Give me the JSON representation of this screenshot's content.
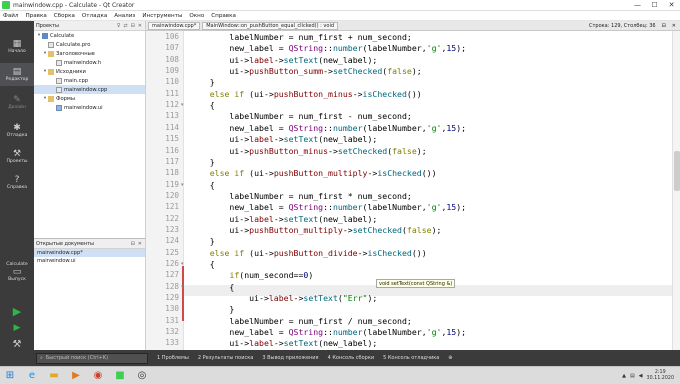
{
  "window": {
    "title": "mainwindow.cpp - Calculate - Qt Creator",
    "controls": [
      "—",
      "☐",
      "✕"
    ]
  },
  "menu": [
    "Файл",
    "Правка",
    "Сборка",
    "Отладка",
    "Анализ",
    "Инструменты",
    "Окно",
    "Справка"
  ],
  "modes": [
    {
      "label": "Начало",
      "icon": "grid-icon"
    },
    {
      "label": "Редактор",
      "icon": "editor-icon"
    },
    {
      "label": "Дизайн",
      "icon": "design-icon"
    },
    {
      "label": "Отладка",
      "icon": "debug-icon"
    },
    {
      "label": "Проекты",
      "icon": "projects-icon"
    },
    {
      "label": "Справка",
      "icon": "help-icon"
    }
  ],
  "kit": {
    "project": "Calculate",
    "mode": "Выпуск"
  },
  "projects_panel": {
    "title": "Проекты",
    "tree": [
      {
        "label": "Calculate",
        "level": 0,
        "arrow": "▾",
        "type": "project"
      },
      {
        "label": "Calculate.pro",
        "level": 1,
        "arrow": "",
        "type": "pro"
      },
      {
        "label": "Заголовочные",
        "level": 1,
        "arrow": "▾",
        "type": "folder"
      },
      {
        "label": "mainwindow.h",
        "level": 2,
        "arrow": "",
        "type": "h"
      },
      {
        "label": "Исходники",
        "level": 1,
        "arrow": "▾",
        "type": "folder"
      },
      {
        "label": "main.cpp",
        "level": 2,
        "arrow": "",
        "type": "cpp"
      },
      {
        "label": "mainwindow.cpp",
        "level": 2,
        "arrow": "",
        "type": "cpp",
        "selected": true
      },
      {
        "label": "Формы",
        "level": 1,
        "arrow": "▾",
        "type": "folder"
      },
      {
        "label": "mainwindow.ui",
        "level": 2,
        "arrow": "",
        "type": "ui"
      }
    ]
  },
  "open_docs": {
    "title": "Открытые документы",
    "items": [
      "mainwindow.cpp*",
      "mainwindow.ui"
    ]
  },
  "editor_tabs": {
    "file": "mainwindow.cpp*",
    "symbol": "MainWindow::on_pushButton_equal_clicked() : void",
    "position": "Строка: 129, Столбец: 36"
  },
  "code": [
    {
      "n": "106",
      "t": "        labelNumber = num_first + num_second;"
    },
    {
      "n": "107",
      "t": "        new_label = QString::number(labelNumber,'g',15);"
    },
    {
      "n": "108",
      "t": "        ui->label->setText(new_label);"
    },
    {
      "n": "109",
      "t": "        ui->pushButton_summ->setChecked(false);"
    },
    {
      "n": "110",
      "t": "    }"
    },
    {
      "n": "111",
      "t": "    else if (ui->pushButton_minus->isChecked())"
    },
    {
      "n": "112",
      "t": "    {"
    },
    {
      "n": "113",
      "t": "        labelNumber = num_first - num_second;"
    },
    {
      "n": "114",
      "t": "        new_label = QString::number(labelNumber,'g',15);"
    },
    {
      "n": "115",
      "t": "        ui->label->setText(new_label);"
    },
    {
      "n": "116",
      "t": "        ui->pushButton_minus->setChecked(false);"
    },
    {
      "n": "117",
      "t": "    }"
    },
    {
      "n": "118",
      "t": "    else if (ui->pushButton_multiply->isChecked())"
    },
    {
      "n": "119",
      "t": "    {"
    },
    {
      "n": "120",
      "t": "        labelNumber = num_first * num_second;"
    },
    {
      "n": "121",
      "t": "        new_label = QString::number(labelNumber,'g',15);"
    },
    {
      "n": "122",
      "t": "        ui->label->setText(new_label);"
    },
    {
      "n": "123",
      "t": "        ui->pushButton_multiply->setChecked(false);"
    },
    {
      "n": "124",
      "t": "    }"
    },
    {
      "n": "125",
      "t": "    else if (ui->pushButton_divide->isChecked())"
    },
    {
      "n": "126",
      "t": "    {"
    },
    {
      "n": "127",
      "t": "        if(num_second==0)"
    },
    {
      "n": "128",
      "t": "        {"
    },
    {
      "n": "129",
      "t": "            ui->label->setText(\"Err\");"
    },
    {
      "n": "130",
      "t": "        }"
    },
    {
      "n": "131",
      "t": "        labelNumber = num_first / num_second;"
    },
    {
      "n": "132",
      "t": "        new_label = QString::number(labelNumber,'g',15);"
    },
    {
      "n": "133",
      "t": "        ui->label->setText(new_label);"
    }
  ],
  "tooltip": "void setText(const QString &)",
  "statusbar": {
    "search_placeholder": "Быстрый поиск (Ctrl+K)",
    "panes": [
      "1 Проблемы",
      "2 Результаты поиска",
      "3 Вывод приложения",
      "4 Консоль сборки",
      "5 Консоль отладчика"
    ],
    "extra": "⊕"
  },
  "taskbar": {
    "time": "2:19",
    "date": "30.11.2020"
  },
  "colors": {
    "keyword": "#808000",
    "function": "#00677c",
    "member": "#800000",
    "class": "#800080",
    "string": "#008000",
    "number": "#000080",
    "sidebar": "#3b3b3b"
  }
}
